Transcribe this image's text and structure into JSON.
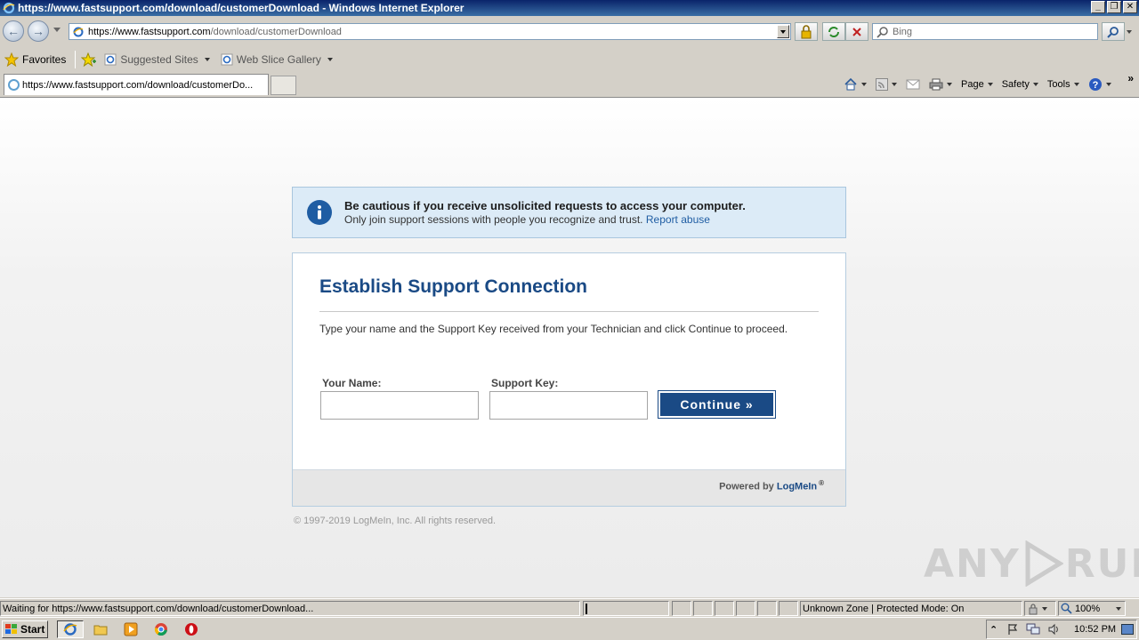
{
  "window": {
    "title": "https://www.fastsupport.com/download/customerDownload - Windows Internet Explorer",
    "min_label": "_",
    "restore_label": "❐",
    "close_label": "✕"
  },
  "address": {
    "url_host": "https://www.fastsupport.com",
    "url_path": "/download/customerDownload"
  },
  "search": {
    "placeholder": "Bing"
  },
  "favorites": {
    "label": "Favorites",
    "links": [
      {
        "label": "Suggested Sites"
      },
      {
        "label": "Web Slice Gallery"
      }
    ]
  },
  "tab": {
    "label": "https://www.fastsupport.com/download/customerDo..."
  },
  "command_bar": {
    "page": "Page",
    "safety": "Safety",
    "tools": "Tools",
    "more": "»"
  },
  "notice": {
    "title": "Be cautious if you receive unsolicited requests to access your computer.",
    "body": "Only join support sessions with people you recognize and trust.",
    "link": "Report abuse"
  },
  "form": {
    "heading": "Establish Support Connection",
    "description": "Type your name and the Support Key received from your Technician and click Continue to proceed.",
    "name_label": "Your Name:",
    "name_value": "",
    "key_label": "Support Key:",
    "key_value": "",
    "continue_label": "Continue »"
  },
  "footer": {
    "powered_prefix": "Powered by",
    "brand": "LogMeIn",
    "reg": "®",
    "copyright": "© 1997-2019 LogMeIn, Inc. All rights reserved."
  },
  "watermark": {
    "left": "ANY",
    "right": "RUN"
  },
  "status": {
    "message": "Waiting for https://www.fastsupport.com/download/customerDownload...",
    "zone": "Unknown Zone | Protected Mode: On",
    "zoom": "100%"
  },
  "taskbar": {
    "start_label": "Start",
    "clock": "10:52 PM"
  },
  "colors": {
    "brand_blue": "#1a4a85",
    "notice_bg": "#dcebf7",
    "link_blue": "#1f5da3"
  }
}
